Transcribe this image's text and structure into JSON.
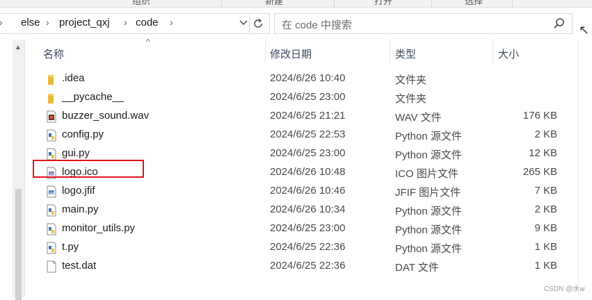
{
  "ribbon": {
    "groups": [
      "组织",
      "新建",
      "打开",
      "选择"
    ]
  },
  "address": {
    "crumbs": [
      "else",
      "project_qxj",
      "code"
    ],
    "refresh_icon": "refresh-icon"
  },
  "search": {
    "placeholder": "在 code 中搜索",
    "icon": "search-icon"
  },
  "help_glyph": "↖个",
  "columns": {
    "name": "名称",
    "date": "修改日期",
    "type": "类型",
    "size": "大小"
  },
  "files": [
    {
      "name": ".idea",
      "date": "2024/6/26 10:40",
      "type": "文件夹",
      "size": "",
      "icon": "folder-icon"
    },
    {
      "name": "__pycache__",
      "date": "2024/6/25 23:00",
      "type": "文件夹",
      "size": "",
      "icon": "folder-icon"
    },
    {
      "name": "buzzer_sound.wav",
      "date": "2024/6/25 21:21",
      "type": "WAV 文件",
      "size": "176 KB",
      "icon": "audio-file-icon"
    },
    {
      "name": "config.py",
      "date": "2024/6/25 22:53",
      "type": "Python 源文件",
      "size": "2 KB",
      "icon": "python-file-icon"
    },
    {
      "name": "gui.py",
      "date": "2024/6/25 23:00",
      "type": "Python 源文件",
      "size": "12 KB",
      "icon": "python-file-icon"
    },
    {
      "name": "logo.ico",
      "date": "2024/6/26 10:48",
      "type": "ICO 图片文件",
      "size": "265 KB",
      "icon": "image-file-icon"
    },
    {
      "name": "logo.jfif",
      "date": "2024/6/26 10:46",
      "type": "JFIF 图片文件",
      "size": "7 KB",
      "icon": "image-file-icon"
    },
    {
      "name": "main.py",
      "date": "2024/6/26 10:34",
      "type": "Python 源文件",
      "size": "2 KB",
      "icon": "python-file-icon"
    },
    {
      "name": "monitor_utils.py",
      "date": "2024/6/25 23:00",
      "type": "Python 源文件",
      "size": "9 KB",
      "icon": "python-file-icon"
    },
    {
      "name": "t.py",
      "date": "2024/6/25 22:36",
      "type": "Python 源文件",
      "size": "1 KB",
      "icon": "python-file-icon"
    },
    {
      "name": "test.dat",
      "date": "2024/6/25 22:36",
      "type": "DAT 文件",
      "size": "1 KB",
      "icon": "generic-file-icon"
    }
  ],
  "highlight_color": "#e0121b",
  "watermark": "CSDN @水w"
}
